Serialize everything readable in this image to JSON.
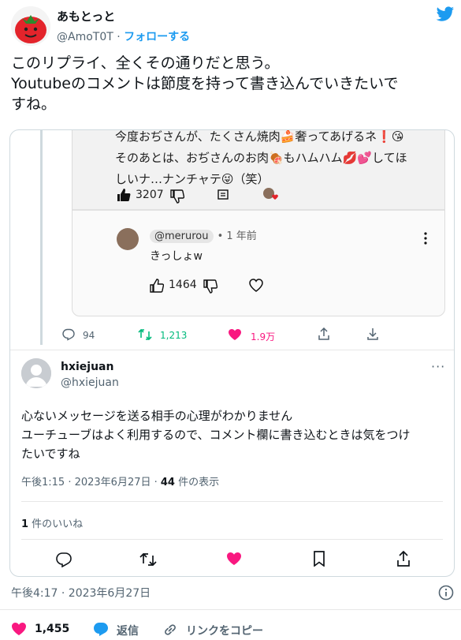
{
  "author": {
    "name": "あもとっと",
    "handle": "@AmoT0T",
    "separator": " · ",
    "follow_label": "フォローする"
  },
  "tweet": {
    "line1": "このリプライ、全くその通りだと思う。",
    "line2": "Youtubeのコメントは節度を持って書き込んでいきたいで",
    "line3": "すね。"
  },
  "youtube_comment": {
    "line1": "今度おぢさんが、たくさん焼肉🍰奢ってあげるネ❗😘",
    "line2": "そのあとは、おぢさんのお肉🍖もハムハム💋💕してほ",
    "line3": "しいナ…ナンチャテ😜（笑）",
    "likes": "3207",
    "reply": {
      "handle": "@merurou",
      "time": "• 1 年前",
      "text": "きっしょw",
      "likes": "1464"
    }
  },
  "quoted_stats": {
    "replies": "94",
    "retweets": "1,213",
    "likes": "1.9万"
  },
  "reply_tweet": {
    "name": "hxiejuan",
    "handle": "@hxiejuan",
    "more": "···",
    "line1": "心ないメッセージを送る相手の心理がわかりません",
    "line2": "ユーチューブはよく利用するので、コメント欄に書き込むときは気をつけ",
    "line3": "たいですね",
    "meta": "午後1:15 · 2023年6月27日 · ",
    "views_count": "44",
    "views_label": " 件の表示",
    "likes_count": "1",
    "likes_label": " 件のいいね"
  },
  "tweet_meta": {
    "timestamp": "午後4:17 · 2023年6月27日"
  },
  "footer": {
    "likes": "1,455",
    "reply_label": "返信",
    "copy_link_label": "リンクをコピー"
  },
  "colors": {
    "accent": "#1d9bf0",
    "like": "#f91880",
    "retweet": "#00ba7c",
    "muted": "#536471"
  }
}
